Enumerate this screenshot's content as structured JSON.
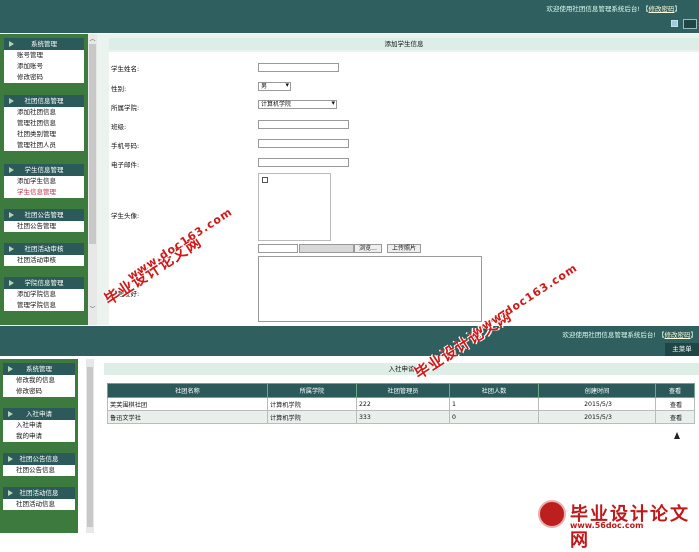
{
  "top": {
    "welcome_text": "欢迎使用社团信息管理系统后台!",
    "welcome_link": "修改密码",
    "sidebar": [
      {
        "title": "系统管理",
        "items": [
          "账号管理",
          "添加账号",
          "修改密码"
        ]
      },
      {
        "title": "社团信息管理",
        "items": [
          "添加社团信息",
          "管理社团信息",
          "社团类别管理",
          "管理社团人员"
        ]
      },
      {
        "title": "学生信息管理",
        "items": [
          "添加学生信息",
          "学生信息管理"
        ]
      },
      {
        "title": "社团公告管理",
        "items": [
          "社团公告管理"
        ]
      },
      {
        "title": "社团活动审核",
        "items": [
          "社团活动审核"
        ]
      },
      {
        "title": "学院信息管理",
        "items": [
          "添加学院信息",
          "管理学院信息"
        ]
      }
    ],
    "form": {
      "title": "添加学生信息",
      "labels": {
        "name": "学生姓名:",
        "gender": "性别:",
        "college": "所属学院:",
        "class": "班级:",
        "phone": "手机号码:",
        "email": "电子邮件:",
        "photo": "学生头像:",
        "hobby": "兴趣爱好:"
      },
      "gender_value": "男",
      "college_value": "计算机学院",
      "browse_label": "浏览...",
      "upload_label": "上传照片"
    }
  },
  "bottom": {
    "welcome_text": "欢迎使用社团信息管理系统后台!",
    "welcome_link": "修改密码",
    "main_menu": "主菜单",
    "sidebar": [
      {
        "title": "系统管理",
        "items": [
          "修改我的信息",
          "修改密码"
        ]
      },
      {
        "title": "入社申请",
        "items": [
          "入社申请",
          "我的申请"
        ]
      },
      {
        "title": "社团公告信息",
        "items": [
          "社团公告信息"
        ]
      },
      {
        "title": "社团活动信息",
        "items": [
          "社团活动信息"
        ]
      }
    ],
    "panel_title": "入社申请",
    "table": {
      "headers": [
        "社团名称",
        "所属学院",
        "社团管理员",
        "社团人数",
        "创建时间",
        "查看"
      ],
      "rows": [
        [
          "芙芙围棋社团",
          "计算机学院",
          "222",
          "1",
          "2015/5/3",
          "查看"
        ],
        [
          "鲁迅文学社",
          "计算机学院",
          "333",
          "0",
          "2015/5/3",
          "查看"
        ]
      ]
    }
  },
  "watermarks": {
    "site_cn": "毕业设计论文网",
    "site_url": "www.doc163.com",
    "logo_url": "www.56doc.com"
  }
}
